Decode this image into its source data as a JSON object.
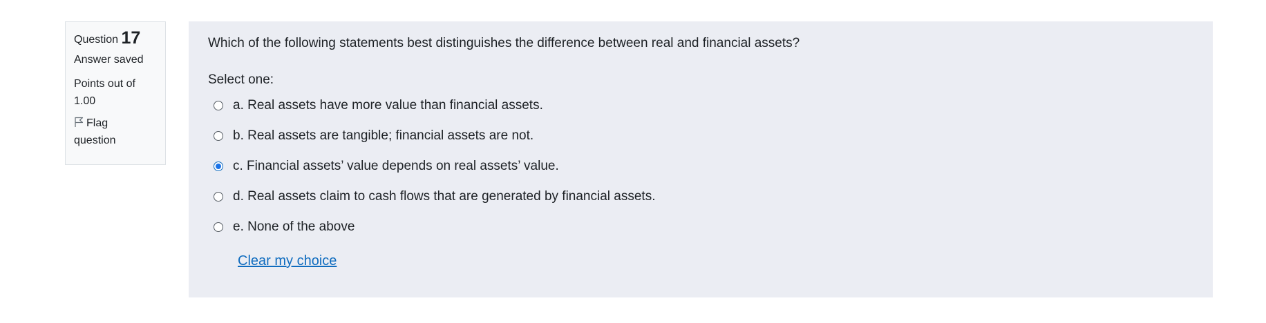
{
  "info": {
    "question_label": "Question",
    "question_number": "17",
    "state": "Answer saved",
    "grade_line1": "Points out of",
    "grade_line2": "1.00",
    "flag_line1": "Flag",
    "flag_line2": "question",
    "flag_icon": "flag-outline-icon"
  },
  "question": {
    "text": "Which of the following statements best distinguishes the difference between real and financial assets?",
    "prompt": "Select one:",
    "options": [
      {
        "label": "a. Real assets have more value than financial assets.",
        "checked": false
      },
      {
        "label": "b. Real assets are tangible; financial assets are not.",
        "checked": false
      },
      {
        "label": "c. Financial assets’ value depends on real assets’ value.",
        "checked": true
      },
      {
        "label": "d. Real assets claim to cash flows that are generated by financial assets.",
        "checked": false
      },
      {
        "label": "e. None of the above",
        "checked": false
      }
    ],
    "clear_label": "Clear my choice"
  },
  "colors": {
    "info_bg": "#f8f9fa",
    "content_bg": "#ebedf3",
    "link": "#0f6cbf",
    "radio_checked": "#1a73e8"
  }
}
